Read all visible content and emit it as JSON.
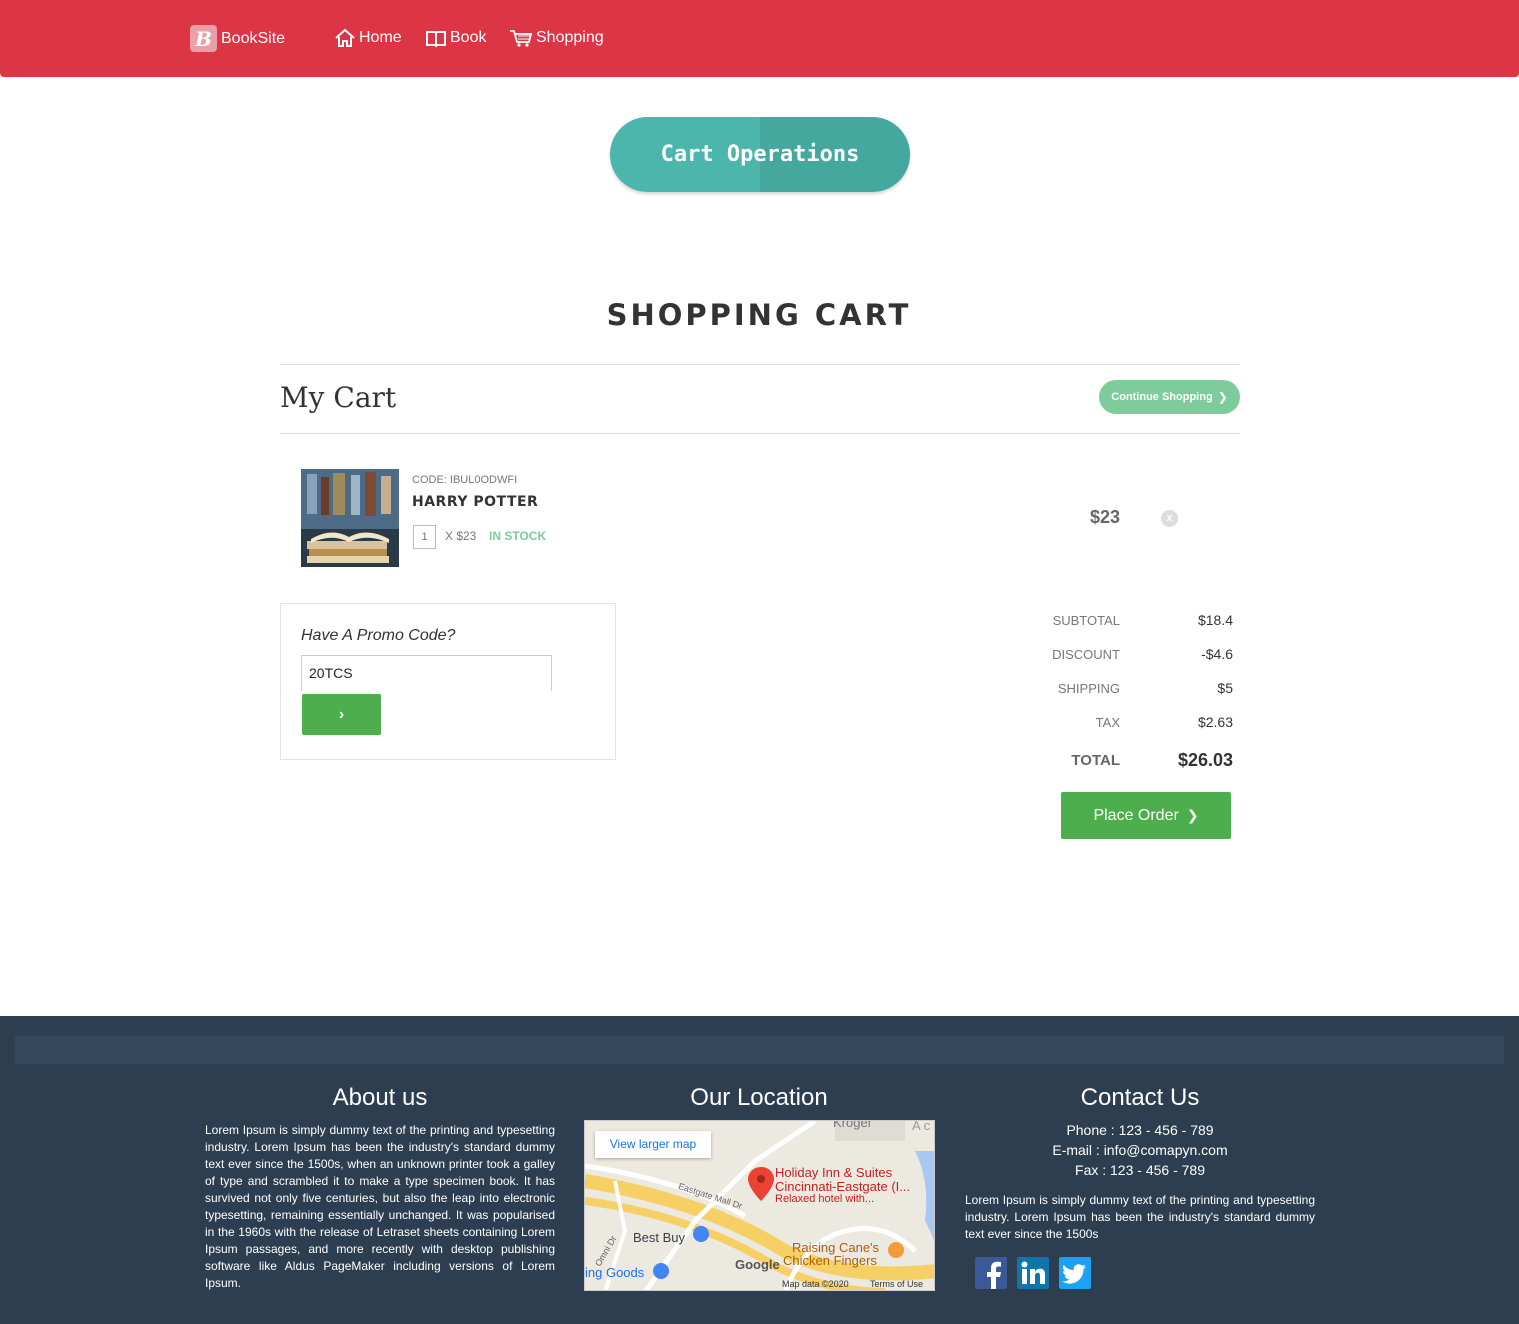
{
  "nav": {
    "brand": "BookSite",
    "brand_letter": "B",
    "links": [
      {
        "label": "Home",
        "icon": "home-icon"
      },
      {
        "label": "Book",
        "icon": "book-icon"
      },
      {
        "label": "Shopping",
        "icon": "cart-icon"
      }
    ]
  },
  "hero": {
    "label": "Cart Operations"
  },
  "cart": {
    "title": "SHOPPING CART",
    "subtitle": "My Cart",
    "continue_label": "Continue Shopping",
    "item": {
      "code": "CODE: IBUL0ODWFI",
      "name": "HARRY POTTER",
      "qty": "1",
      "unit_price": "X $23",
      "stock": "IN STOCK",
      "price": "$23",
      "remove_icon": "x"
    }
  },
  "promo": {
    "question": "Have A Promo Code?",
    "value": "20TCS",
    "submit_label": "›"
  },
  "summary": {
    "subtotal_label": "SUBTOTAL",
    "subtotal": "$18.4",
    "discount_label": "DISCOUNT",
    "discount": "-$4.6",
    "shipping_label": "SHIPPING",
    "shipping": "$5",
    "tax_label": "TAX",
    "tax": "$2.63",
    "total_label": "TOTAL",
    "total": "$26.03",
    "order_label": "Place Order"
  },
  "footer": {
    "about_title": "About us",
    "about_text": "Lorem Ipsum is simply dummy text of the printing and typesetting industry. Lorem Ipsum has been the industry's standard dummy text ever since the 1500s, when an unknown printer took a galley of type and scrambled it to make a type specimen book. It has survived not only five centuries, but also the leap into electronic typesetting, remaining essentially unchanged. It was popularised in the 1960s with the release of Letraset sheets containing Lorem Ipsum passages, and more recently with desktop publishing software like Aldus PageMaker including versions of Lorem Ipsum.",
    "location_title": "Our Location",
    "map": {
      "view_larger": "View larger map",
      "place_name": "Holiday Inn & Suites",
      "place_name2": "Cincinnati-Eastgate (I...",
      "place_desc": "Relaxed hotel with...",
      "poi1": "Best Buy",
      "poi2": "Raising Cane's",
      "poi2b": "Chicken Fingers",
      "poi3": "ing Goods",
      "poi4": "Kroger",
      "road1": "Eastgate Mall Dr",
      "road2": "Omni Dr",
      "road3": "A c",
      "google": "Google",
      "data": "Map data ©2020",
      "terms": "Terms of Use"
    },
    "contact_title": "Contact Us",
    "phone": "Phone : 123 - 456 - 789",
    "email": "E-mail : info@comapyn.com",
    "fax": "Fax : 123 - 456 - 789",
    "contact_text": "Lorem Ipsum is simply dummy text of the printing and typesetting industry. Lorem Ipsum has been the industry's standard dummy text ever since the 1500s",
    "social": [
      {
        "name": "facebook-icon",
        "color": "#3b5998"
      },
      {
        "name": "linkedin-icon",
        "color": "#0e76a8"
      },
      {
        "name": "twitter-icon",
        "color": "#1da1f2"
      }
    ]
  },
  "colors": {
    "navbar": "#dc3545",
    "teal": "#4db6ac",
    "green": "#4cae4c",
    "mint": "#7ecb9b",
    "footer": "#2c3e50"
  }
}
